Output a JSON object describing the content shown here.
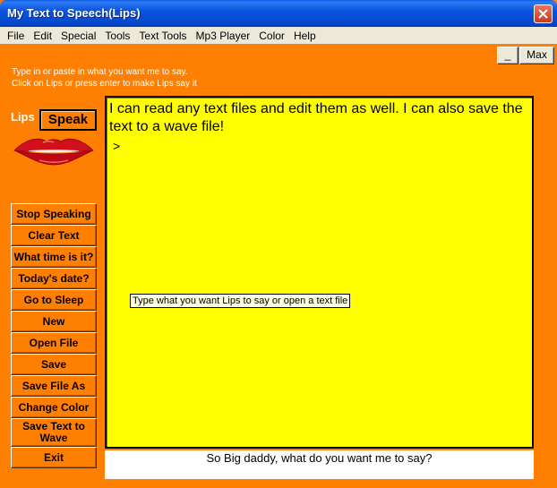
{
  "window": {
    "title": "My Text to Speech(Lips)"
  },
  "menu": [
    "File",
    "Edit",
    "Special",
    "Tools",
    "Text Tools",
    "Mp3 Player",
    "Color",
    "Help"
  ],
  "system_buttons": {
    "minimize": "_",
    "max": "Max"
  },
  "instructions": [
    "Type in or paste in what you want me to say.",
    "Click on Lips or press enter to make Lips say it"
  ],
  "lips_label": "Lips",
  "speak_button": "Speak",
  "commands": [
    "Stop Speaking",
    "Clear Text",
    "What time is it?",
    "Today's date?",
    "Go to Sleep",
    "New",
    "Open File",
    "Save",
    "Save File As",
    "Change Color",
    "Save Text to Wave",
    "Exit"
  ],
  "text_area": {
    "content": "I can read any text files and edit them as well. I can also save the text to a wave file!",
    "prompt": ">"
  },
  "tooltip": "Type what you want Lips to say or open a text file",
  "status_message": "So Big daddy, what do you want me to say?",
  "colors": {
    "background": "#ff8000",
    "text_area": "#ffff00",
    "title_bar": "#0a53e0",
    "lips": "#d0101a"
  },
  "icons": {
    "close": "close-icon",
    "lips": "lips-icon"
  }
}
